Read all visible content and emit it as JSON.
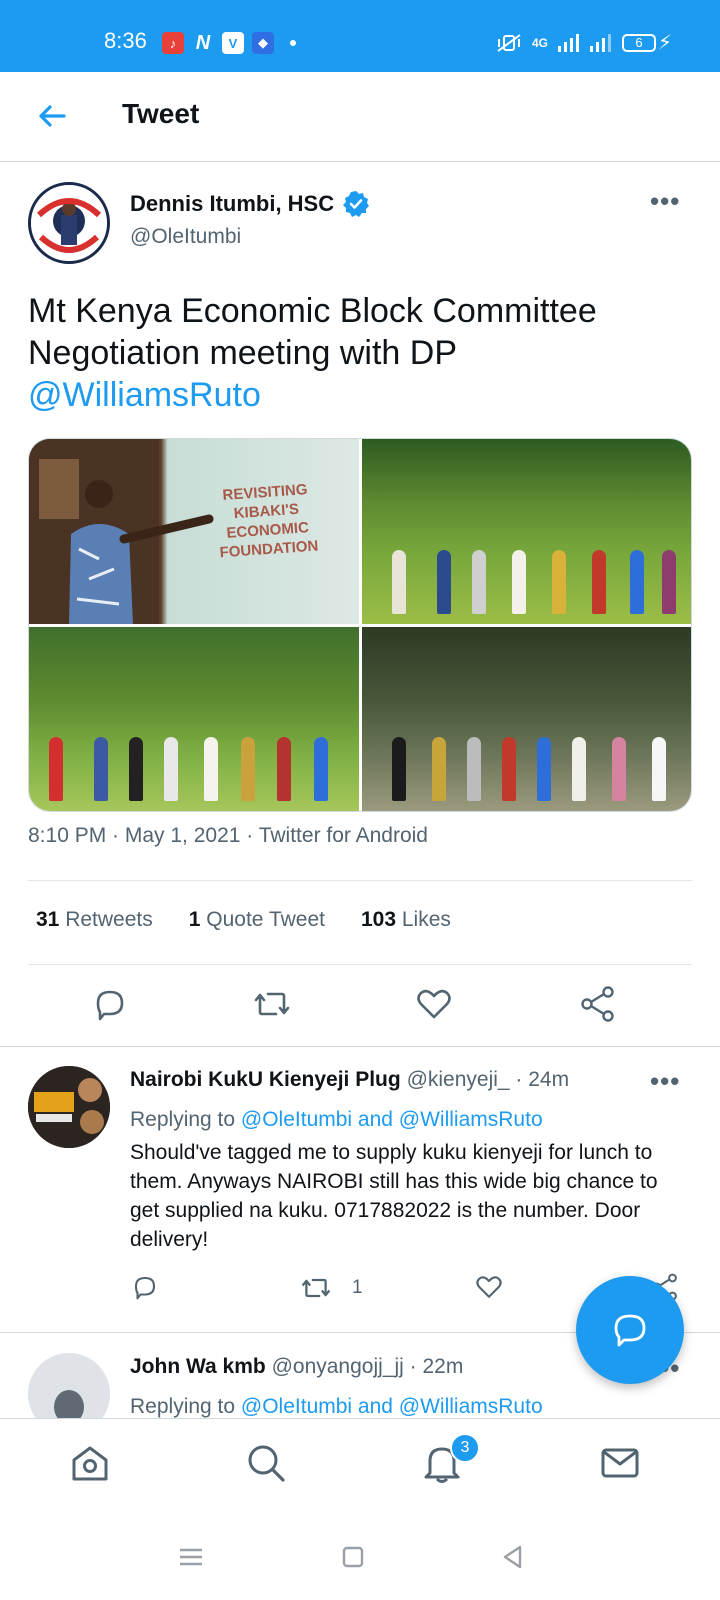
{
  "status_bar": {
    "time": "8:36",
    "network": "4G",
    "battery": "6",
    "left_icons": [
      "music-app-icon",
      "n-app-icon",
      "v-app-icon",
      "android-app-icon"
    ]
  },
  "header": {
    "title": "Tweet"
  },
  "tweet": {
    "author_name": "Dennis Itumbi, HSC",
    "author_handle": "@OleItumbi",
    "text_plain": "Mt Kenya Economic Block Committee Negotiation meeting with DP ",
    "text_mention": "@WilliamsRuto",
    "slide_text": "REVISITING KIBAKI'S ECONOMIC FOUNDATION",
    "avatar_text": "I'VE GOT YOUR BACK",
    "meta": "8:10 PM · May 1, 2021 · Twitter for Android",
    "stats": {
      "retweets_count": "31",
      "retweets_label": "Retweets",
      "quotes_count": "1",
      "quotes_label": "Quote Tweet",
      "likes_count": "103",
      "likes_label": "Likes"
    }
  },
  "replies": [
    {
      "name": "Nairobi KukU Kienyeji Plug",
      "handle_time": "@kienyeji_ · 24m",
      "replying_prefix": "Replying to ",
      "replying_to": "@OleItumbi and @WilliamsRuto",
      "body": "Should've tagged me to supply kuku kienyeji for lunch to them. Anyways NAIROBI still has this wide big chance to get supplied na kuku. 0717882022 is the number. Door delivery!",
      "retweet_count": "1",
      "avatar_text": "NAIROBI KUKU KIENYEJI"
    },
    {
      "name": "John Wa kmb",
      "handle_time": "@onyangojj_jj · 22m",
      "replying_prefix": "Replying to ",
      "replying_to": "@OleItumbi and @WilliamsRuto"
    }
  ],
  "bottom_nav": {
    "notification_badge": "3"
  },
  "colors": {
    "accent": "#1d9bf0",
    "text": "#0f1419",
    "secondary": "#536471"
  }
}
